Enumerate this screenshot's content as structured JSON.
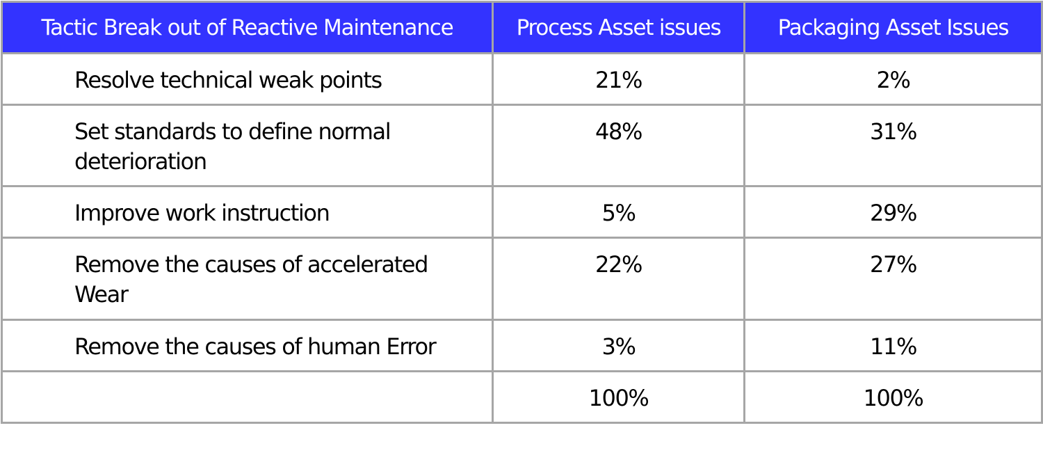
{
  "table": {
    "header_bg_color": "#3333ff",
    "border_color": "#a6a6a6",
    "headers": [
      "Tactic Break out of Reactive Maintenance",
      "Process Asset issues",
      "Packaging Asset Issues"
    ],
    "rows": [
      {
        "tactic": "Resolve technical weak points",
        "process": "21%",
        "packaging": "2%"
      },
      {
        "tactic": "Set standards to define normal deterioration",
        "process": "48%",
        "packaging": "31%"
      },
      {
        "tactic": "Improve work instruction",
        "process": "5%",
        "packaging": "29%"
      },
      {
        "tactic": "Remove the causes of accelerated Wear",
        "process": "22%",
        "packaging": "27%"
      },
      {
        "tactic": "Remove the causes of human Error",
        "process": "3%",
        "packaging": "11%"
      }
    ],
    "total_row": {
      "tactic": "",
      "process": "100%",
      "packaging": "100%"
    }
  }
}
